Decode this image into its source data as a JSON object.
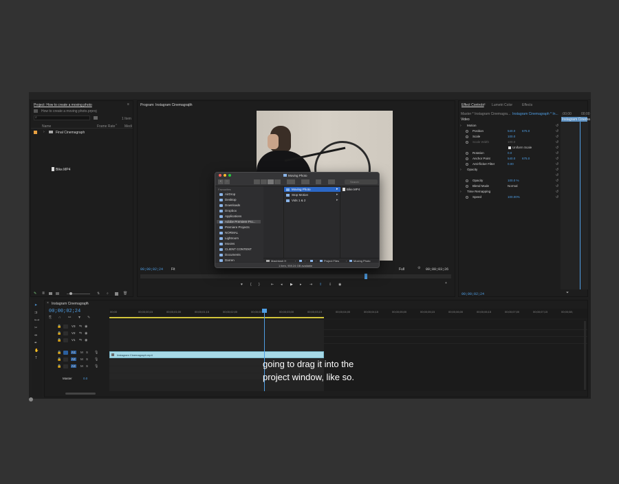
{
  "project": {
    "tab": "Project: How to create a moving photo",
    "file": "How to create a moving photo.prproj",
    "item_count": "1 Item",
    "col_name": "Name",
    "col_frame_rate": "Frame Rate",
    "col_media": "Medi",
    "bin": "Final Cinemagraph",
    "drag_file": "Bike.MP4"
  },
  "program": {
    "tab": "Program: Instagram Cinemagraph",
    "timecode": "00;00;02;24",
    "fit": "Fit",
    "full": "Full",
    "duration": "00;00;03;26"
  },
  "effects": {
    "tabs": [
      "Effect Controls",
      "Lumetri Color",
      "Effects"
    ],
    "master": "Master * Instagram Cinemagra...",
    "sequence": "Instagram Cinemagraph * In...",
    "clip_label": "Instagram Cinema",
    "ruler_start": ";00;00",
    "ruler_end": "00;00",
    "video_label": "Video",
    "rows": [
      {
        "name": "Motion",
        "v1": "",
        "v2": "",
        "fx": true
      },
      {
        "name": "Position",
        "v1": "540.0",
        "v2": "675.0"
      },
      {
        "name": "Scale",
        "v1": "100.0",
        "v2": ""
      },
      {
        "name": "Scale Width",
        "v1": "100.0",
        "v2": ""
      },
      {
        "name": "",
        "v1": "Uniform Scale",
        "v2": ""
      },
      {
        "name": "Rotation",
        "v1": "0.0",
        "v2": ""
      },
      {
        "name": "Anchor Point",
        "v1": "540.0",
        "v2": "675.0"
      },
      {
        "name": "Anti-flicker Filter",
        "v1": "0.00",
        "v2": ""
      },
      {
        "name": "Opacity",
        "v1": "",
        "v2": "",
        "fx": true
      },
      {
        "name": "",
        "v1": "",
        "v2": ""
      },
      {
        "name": "Opacity",
        "v1": "100.0 %",
        "v2": ""
      },
      {
        "name": "Blend Mode",
        "v1": "Normal",
        "v2": ""
      },
      {
        "name": "Time Remapping",
        "v1": "",
        "v2": "",
        "fx": true
      },
      {
        "name": "Speed",
        "v1": "100.00%",
        "v2": ""
      }
    ],
    "footer_timecode": "00;00;02;24"
  },
  "timeline": {
    "tab": "Instagram Cinemagraph",
    "timecode": "00;00;02;24",
    "ruler": [
      "00;00",
      "00;00;00;15",
      "00;00;01;00",
      "00;00;01;15",
      "00;00;02;00",
      "00;00;02;15",
      "00;00;03;00",
      "00;00;03;15",
      "00;00;04;00",
      "00;00;04;15",
      "00;00;05;00",
      "00;00;05;15",
      "00;00;06;00",
      "00;00;06;15",
      "00;00;07;00",
      "00;00;07;15",
      "00;00;08;"
    ],
    "video_tracks": [
      "V3",
      "V2",
      "V1"
    ],
    "audio_tracks": [
      "A1",
      "A2",
      "A3"
    ],
    "master_label": "Master",
    "master_value": "0.0",
    "clip_name": "Instagram Cinemagraph.mp4",
    "track_buttons": [
      "M",
      "S"
    ]
  },
  "finder": {
    "title": "Moving Photo",
    "search_placeholder": "Search",
    "favourites_label": "Favourites",
    "sidebar": [
      "AirDrop",
      "Desktop",
      "Downloads",
      "Dropbox",
      "Applications",
      "Adobe Premiere Pro...",
      "Premiere Projects",
      "NORMAL",
      "Lightroom",
      "Movies",
      "CLIENT CONTENT",
      "Documents",
      "Darren"
    ],
    "col2": [
      "Moving Photo",
      "Stop Motion",
      "Vids 1 & 2"
    ],
    "col3": [
      "Bike.MP4"
    ],
    "path": [
      "Macintosh H",
      "Project Files",
      "Moving Photo"
    ],
    "status": "1 item, 959.24 GB available"
  },
  "caption": {
    "line1": "going to drag it into the",
    "line2": "project window, like so."
  },
  "colors": {
    "accent": "#4f9fe6",
    "clip": "#a6d8e6",
    "playhead": "#4f9fe6"
  }
}
